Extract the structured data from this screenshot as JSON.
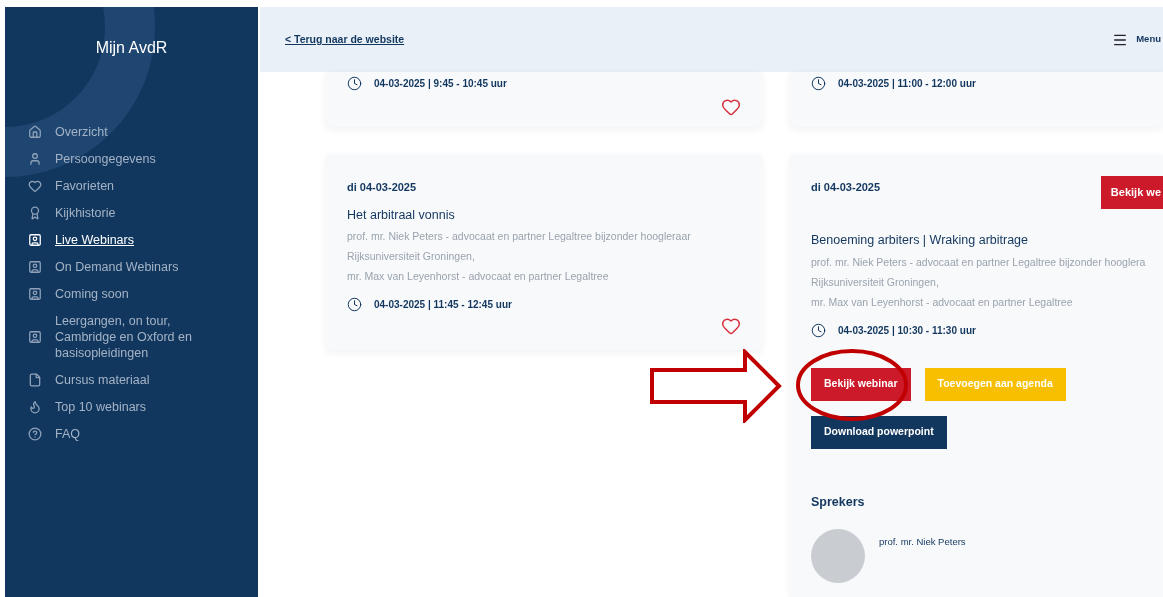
{
  "sidebar": {
    "title": "Mijn AvdR",
    "items": [
      {
        "label": "Overzicht",
        "kind": "home",
        "selected": false
      },
      {
        "label": "Persoongegevens",
        "kind": "user",
        "selected": false
      },
      {
        "label": "Favorieten",
        "kind": "heart",
        "selected": false
      },
      {
        "label": "Kijkhistorie",
        "kind": "award",
        "selected": false
      },
      {
        "label": "Live Webinars",
        "kind": "card",
        "selected": true
      },
      {
        "label": "On Demand Webinars",
        "kind": "card",
        "selected": false
      },
      {
        "label": "Coming soon",
        "kind": "card",
        "selected": false
      },
      {
        "label": "Leergangen, on tour, Cambridge en Oxford en basisopleidingen",
        "kind": "card",
        "selected": false
      },
      {
        "label": "Cursus materiaal",
        "kind": "file",
        "selected": false
      },
      {
        "label": "Top 10 webinars",
        "kind": "flame",
        "selected": false
      },
      {
        "label": "FAQ",
        "kind": "help",
        "selected": false
      }
    ]
  },
  "header": {
    "back_link": "< Terug naar de website",
    "menu_label": "Menu"
  },
  "columns": [
    {
      "cards": [
        {
          "kind": "partial",
          "time": "04-03-2025 | 9:45 - 10:45 uur",
          "favorited": false
        },
        {
          "kind": "full",
          "date": "di 04-03-2025",
          "title": "Het arbitraal vonnis",
          "speaker_lines": [
            "prof. mr. Niek Peters - advocaat en partner Legaltree bijzonder hoogleraar",
            "Rijksuniversiteit Groningen,",
            "mr. Max van Leyenhorst - advocaat en partner Legaltree"
          ],
          "time": "04-03-2025 | 11:45 - 12:45 uur",
          "favorited": false
        }
      ]
    },
    {
      "cards": [
        {
          "kind": "partial",
          "time": "04-03-2025 | 11:00 - 12:00 uur"
        },
        {
          "kind": "detail",
          "date": "di 04-03-2025",
          "header_button": "Bekijk we",
          "title": "Benoeming arbiters | Wraking arbitrage",
          "speaker_lines": [
            "prof. mr. Niek Peters - advocaat en partner Legaltree bijzonder hooglera",
            "Rijksuniversiteit Groningen,",
            "mr. Max van Leyenhorst - advocaat en partner Legaltree"
          ],
          "time": "04-03-2025 | 10:30 - 11:30 uur",
          "buttons": [
            {
              "label": "Bekijk webinar",
              "kind": "watch"
            },
            {
              "label": "Toevoegen aan agenda",
              "kind": "agenda"
            },
            {
              "label": "Download powerpoint",
              "kind": "download"
            }
          ],
          "speakers_heading": "Sprekers",
          "speakers": [
            {
              "name": "prof. mr. Niek Peters"
            }
          ]
        }
      ]
    }
  ]
}
